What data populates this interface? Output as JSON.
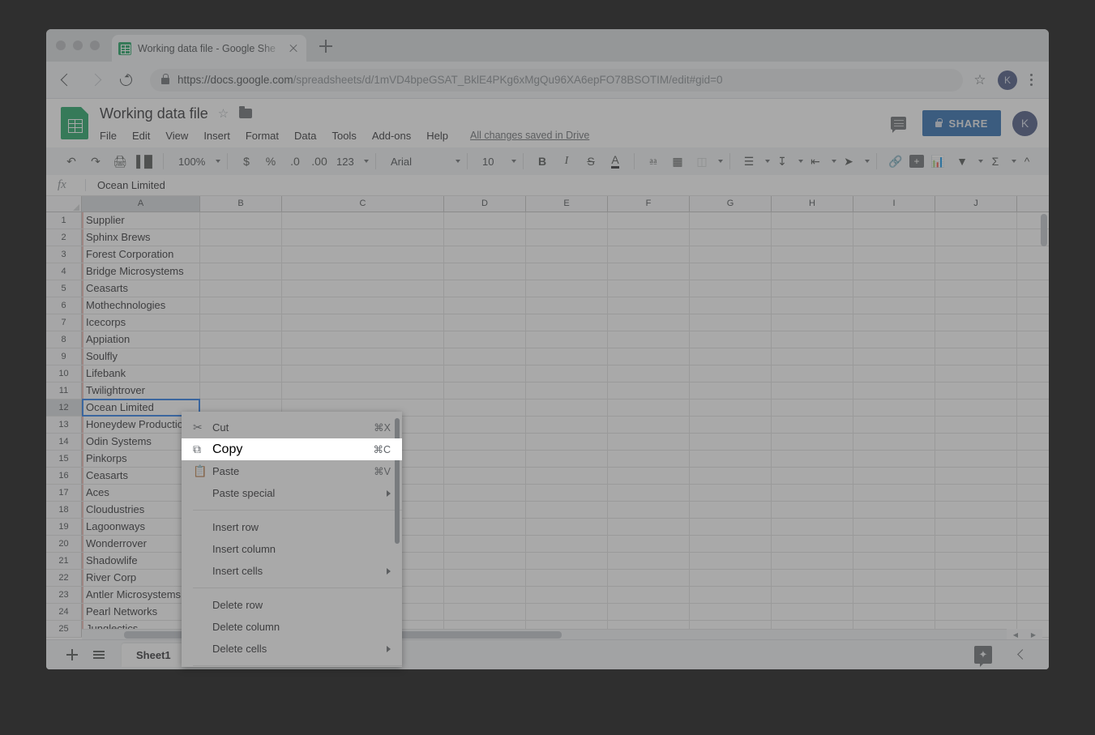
{
  "browser": {
    "tab_title": "Working data file - Google She",
    "url_host": "https://docs.google.com",
    "url_path": "/spreadsheets/d/1mVD4bpeGSAT_BklE4PKg6xMgQu96XA6epFO78BSOTIM/edit#gid=0",
    "new_tab_label": "+",
    "avatar_initial": "K"
  },
  "header": {
    "doc_title": "Working data file",
    "menu": [
      "File",
      "Edit",
      "View",
      "Insert",
      "Format",
      "Data",
      "Tools",
      "Add-ons",
      "Help"
    ],
    "save_status": "All changes saved in Drive",
    "share_label": "SHARE",
    "account_initial": "K"
  },
  "toolbar": {
    "zoom": "100%",
    "currency": "$",
    "percent": "%",
    "decimal_decrease": ".0",
    "decimal_increase": ".00",
    "number_format": "123",
    "font": "Arial",
    "font_size": "10",
    "bold": "B",
    "italic": "I",
    "strikethrough": "S",
    "text_color": "A"
  },
  "formula_bar": {
    "fx": "fx",
    "value": "Ocean Limited"
  },
  "grid": {
    "columns": [
      "A",
      "B",
      "C",
      "D",
      "E",
      "F",
      "G",
      "H",
      "I",
      "J"
    ],
    "selected_cell": "A12",
    "rows": [
      {
        "num": "1",
        "a": "Supplier"
      },
      {
        "num": "2",
        "a": "Sphinx Brews"
      },
      {
        "num": "3",
        "a": "Forest Corporation"
      },
      {
        "num": "4",
        "a": "Bridge Microsystems"
      },
      {
        "num": "5",
        "a": "Ceasarts"
      },
      {
        "num": "6",
        "a": "Mothechnologies"
      },
      {
        "num": "7",
        "a": "Icecorps"
      },
      {
        "num": "8",
        "a": "Appiation"
      },
      {
        "num": "9",
        "a": "Soulfly"
      },
      {
        "num": "10",
        "a": "Lifebank"
      },
      {
        "num": "11",
        "a": "Twilightrover"
      },
      {
        "num": "12",
        "a": "Ocean Limited"
      },
      {
        "num": "13",
        "a": "Honeydew Production"
      },
      {
        "num": "14",
        "a": "Odin Systems"
      },
      {
        "num": "15",
        "a": "Pinkorps"
      },
      {
        "num": "16",
        "a": "Ceasarts"
      },
      {
        "num": "17",
        "a": "Aces"
      },
      {
        "num": "18",
        "a": "Cloudustries"
      },
      {
        "num": "19",
        "a": "Lagoonways"
      },
      {
        "num": "20",
        "a": "Wonderrover"
      },
      {
        "num": "21",
        "a": "Shadowlife"
      },
      {
        "num": "22",
        "a": "River Corp"
      },
      {
        "num": "23",
        "a": "Antler Microsystems"
      },
      {
        "num": "24",
        "a": "Pearl Networks"
      },
      {
        "num": "25",
        "a": "Junglectics"
      }
    ]
  },
  "context_menu": {
    "items": [
      {
        "label": "Cut",
        "accel": "⌘X",
        "icon": "scissors-icon",
        "arrow": false,
        "highlight": false
      },
      {
        "label": "Copy",
        "accel": "⌘C",
        "icon": "copy-icon",
        "arrow": false,
        "highlight": true
      },
      {
        "label": "Paste",
        "accel": "⌘V",
        "icon": "clipboard-icon",
        "arrow": false,
        "highlight": false
      },
      {
        "label": "Paste special",
        "accel": "",
        "icon": "",
        "arrow": true,
        "highlight": false
      },
      {
        "label": "Insert row",
        "accel": "",
        "icon": "",
        "arrow": false,
        "highlight": false
      },
      {
        "label": "Insert column",
        "accel": "",
        "icon": "",
        "arrow": false,
        "highlight": false
      },
      {
        "label": "Insert cells",
        "accel": "",
        "icon": "",
        "arrow": true,
        "highlight": false
      },
      {
        "label": "Delete row",
        "accel": "",
        "icon": "",
        "arrow": false,
        "highlight": false
      },
      {
        "label": "Delete column",
        "accel": "",
        "icon": "",
        "arrow": false,
        "highlight": false
      },
      {
        "label": "Delete cells",
        "accel": "",
        "icon": "",
        "arrow": true,
        "highlight": false
      }
    ]
  },
  "bottom": {
    "sheet_tab": "Sheet1"
  },
  "colors": {
    "brand_green": "#0f9d58",
    "share_blue": "#1a5fa8",
    "selection_blue": "#1a73e8",
    "avatar": "#3b4a78"
  }
}
